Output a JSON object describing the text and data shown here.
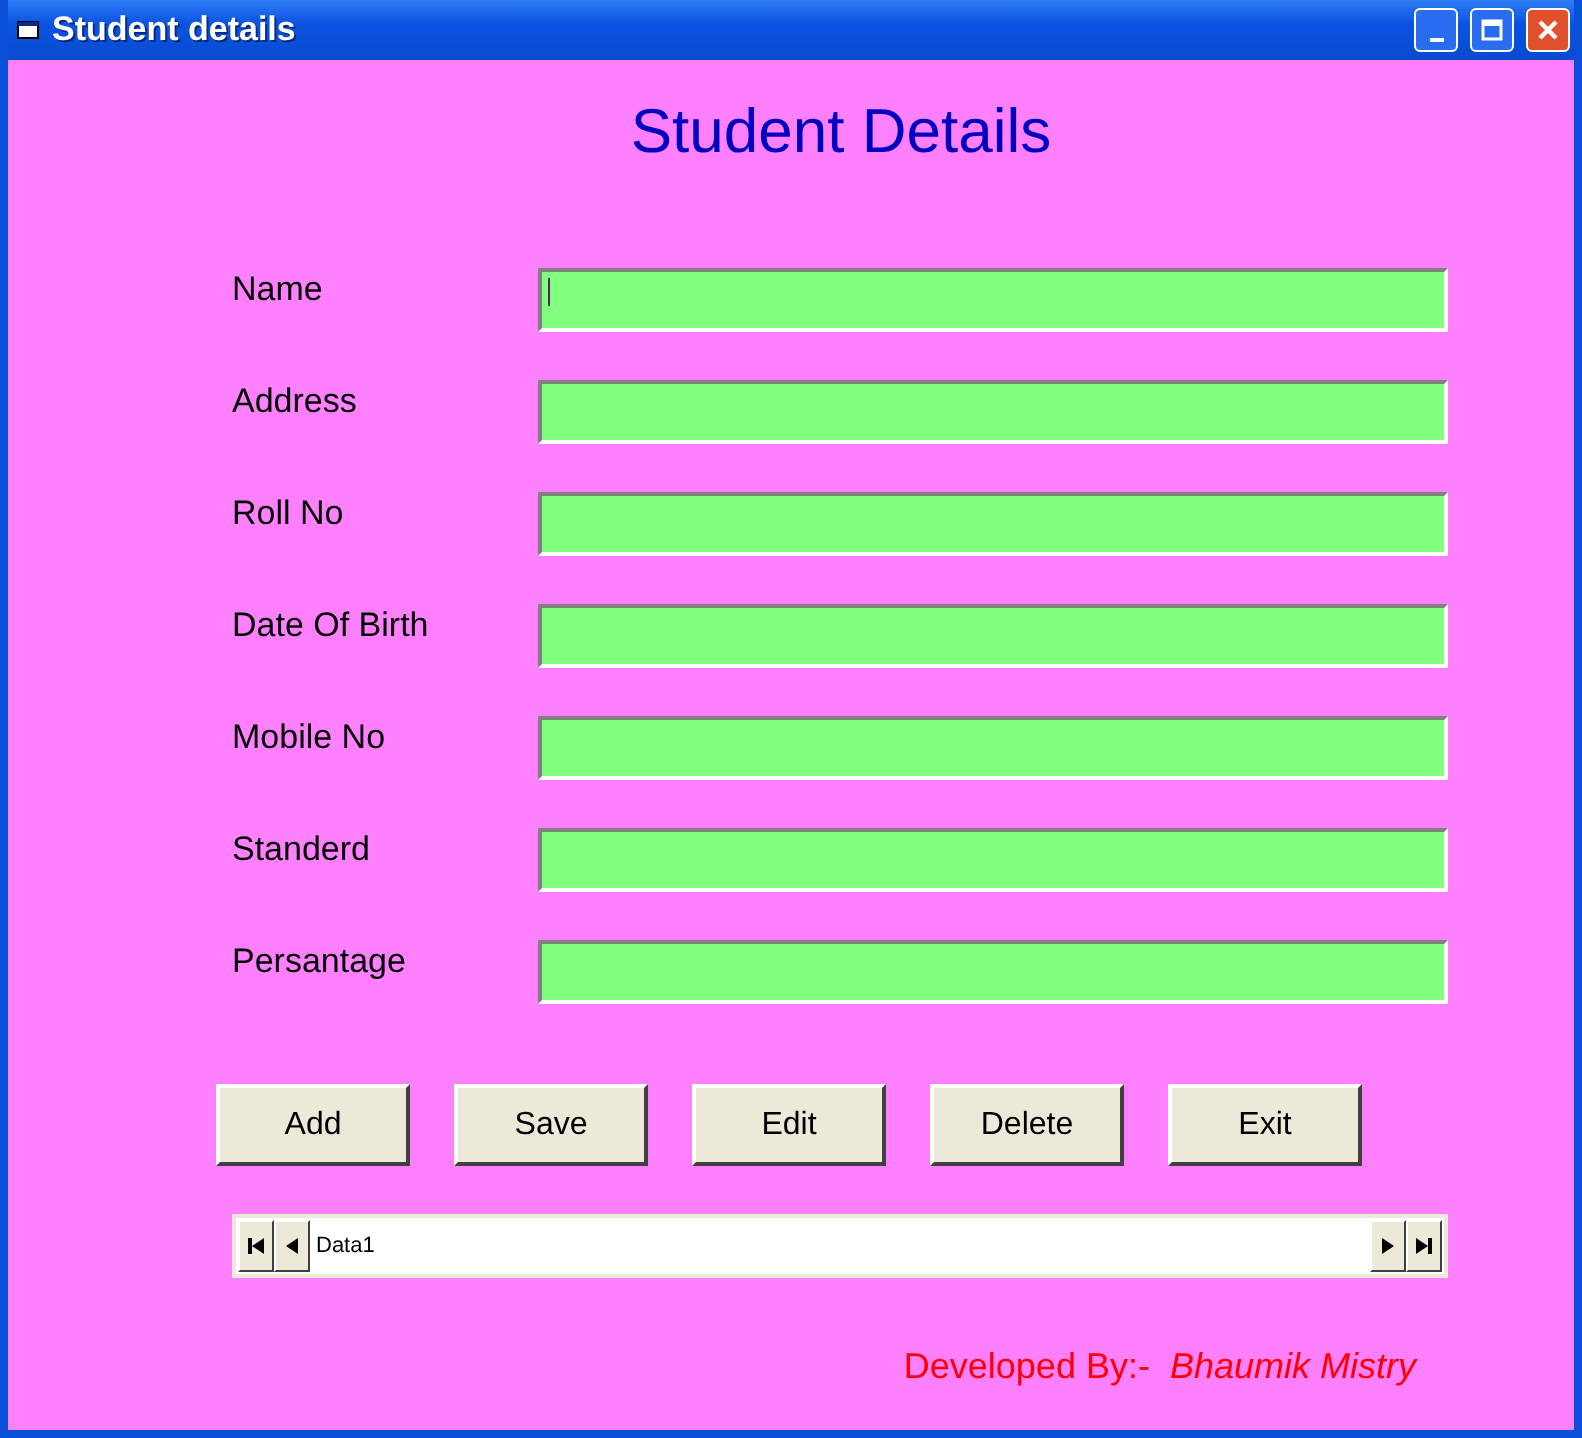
{
  "window": {
    "title": "Student details"
  },
  "heading": "Student Details",
  "fields": [
    {
      "label": "Name",
      "focused": true
    },
    {
      "label": "Address",
      "focused": false
    },
    {
      "label": "Roll No",
      "focused": false
    },
    {
      "label": "Date Of Birth",
      "focused": false
    },
    {
      "label": "Mobile No",
      "focused": false
    },
    {
      "label": "Standerd",
      "focused": false
    },
    {
      "label": "Persantage",
      "focused": false
    }
  ],
  "buttons": [
    "Add",
    "Save",
    "Edit",
    "Delete",
    "Exit"
  ],
  "data_control": {
    "caption": "Data1"
  },
  "footer": {
    "label": "Developed By:-",
    "author": "Bhaumik Mistry"
  }
}
